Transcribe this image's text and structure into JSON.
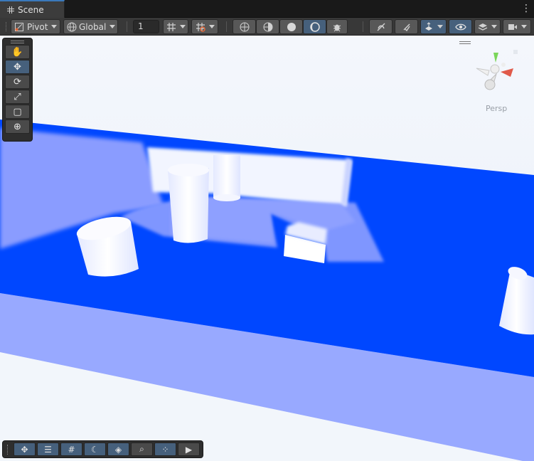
{
  "tab": {
    "title": "Scene",
    "icon": "grid-icon"
  },
  "menu": {
    "icon": "kebab-menu-icon",
    "glyph": "⋮"
  },
  "toolbar": {
    "pivot_label": "Pivot",
    "global_label": "Global",
    "grid_size_value": "1",
    "icons": {
      "pivot": "pivot-icon",
      "global": "globe-icon",
      "grid_snap": "grid-snap-icon",
      "increment_snap": "increment-snap-icon",
      "wireframe": "wireframe-shading-icon",
      "shaded_wire": "shaded-wireframe-icon",
      "shaded": "shaded-icon",
      "lighting": "lighting-icon",
      "debug": "debug-bug-icon",
      "effects_off": "effects-toggle-icon",
      "audio": "audio-toggle-icon",
      "fx": "scene-fx-icon",
      "visibility": "visibility-eye-icon",
      "layers": "layers-icon",
      "camera": "camera-icon"
    }
  },
  "tools": {
    "items": [
      {
        "name": "hand-tool",
        "glyph": "✋"
      },
      {
        "name": "move-tool",
        "glyph": "✥"
      },
      {
        "name": "rotate-tool",
        "glyph": "⟳"
      },
      {
        "name": "scale-tool",
        "glyph": "⤢"
      },
      {
        "name": "rect-tool",
        "glyph": "▢"
      },
      {
        "name": "transform-tool",
        "glyph": "⊕"
      }
    ],
    "active_index": 1
  },
  "gizmo": {
    "projection_label": "Persp"
  },
  "overlays": {
    "items": [
      {
        "name": "move-overlay",
        "glyph": "✥"
      },
      {
        "name": "sliders-overlay",
        "glyph": "☰"
      },
      {
        "name": "grid-overlay",
        "glyph": "#"
      },
      {
        "name": "lighting-overlay",
        "glyph": "☾"
      },
      {
        "name": "layers-overlay",
        "glyph": "◈"
      },
      {
        "name": "search-overlay",
        "glyph": "⌕"
      },
      {
        "name": "nodes-overlay",
        "glyph": "⁘"
      },
      {
        "name": "camera-overlay",
        "glyph": "▶"
      }
    ]
  },
  "colors": {
    "floor": "#0048ff",
    "floor_edge": "#94a6ff",
    "sky": "#eef3fb",
    "shadow": "#8499ff",
    "active_button": "#46607c",
    "gizmo_y": "#7bd65a",
    "gizmo_x": "#e05a4a"
  }
}
